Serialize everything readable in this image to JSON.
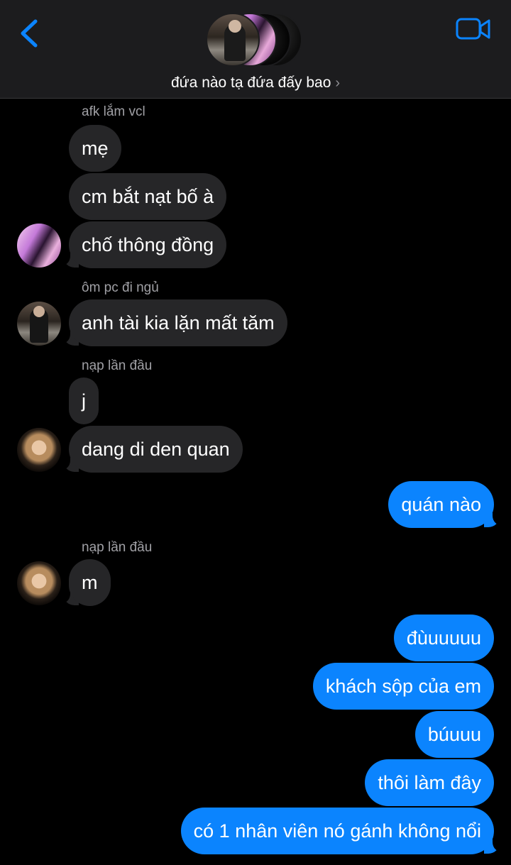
{
  "header": {
    "group_name": "đứa nào tạ đứa đấy bao",
    "chevron": "›",
    "back_icon": "chevron-left-icon",
    "video_icon": "video-camera-icon",
    "accent_color": "#0b84fe"
  },
  "messages": [
    {
      "sender": "afk lắm vcl",
      "text": "mẹ",
      "direction": "incoming"
    },
    {
      "text": "cm bắt nạt bố à",
      "direction": "incoming"
    },
    {
      "text": "chố thông đồng",
      "direction": "incoming"
    },
    {
      "sender": "ôm pc đi ngủ",
      "text": "anh tài kia lặn mất tăm",
      "direction": "incoming"
    },
    {
      "sender": "nạp lần đầu",
      "text": "j",
      "direction": "incoming"
    },
    {
      "text": "dang di den quan",
      "direction": "incoming"
    },
    {
      "text": "quán nào",
      "direction": "outgoing"
    },
    {
      "sender": "nạp lần đầu",
      "text": "m",
      "direction": "incoming"
    },
    {
      "text": "đùuuuuu",
      "direction": "outgoing"
    },
    {
      "text": "khách sộp của em",
      "direction": "outgoing"
    },
    {
      "text": "búuuu",
      "direction": "outgoing"
    },
    {
      "text": "thôi làm đây",
      "direction": "outgoing"
    },
    {
      "text": "có 1 nhân viên nó gánh không nổi",
      "direction": "outgoing"
    }
  ],
  "colors": {
    "incoming_bubble": "#262628",
    "outgoing_bubble": "#0b84fe",
    "header_bg": "#1c1c1e"
  }
}
